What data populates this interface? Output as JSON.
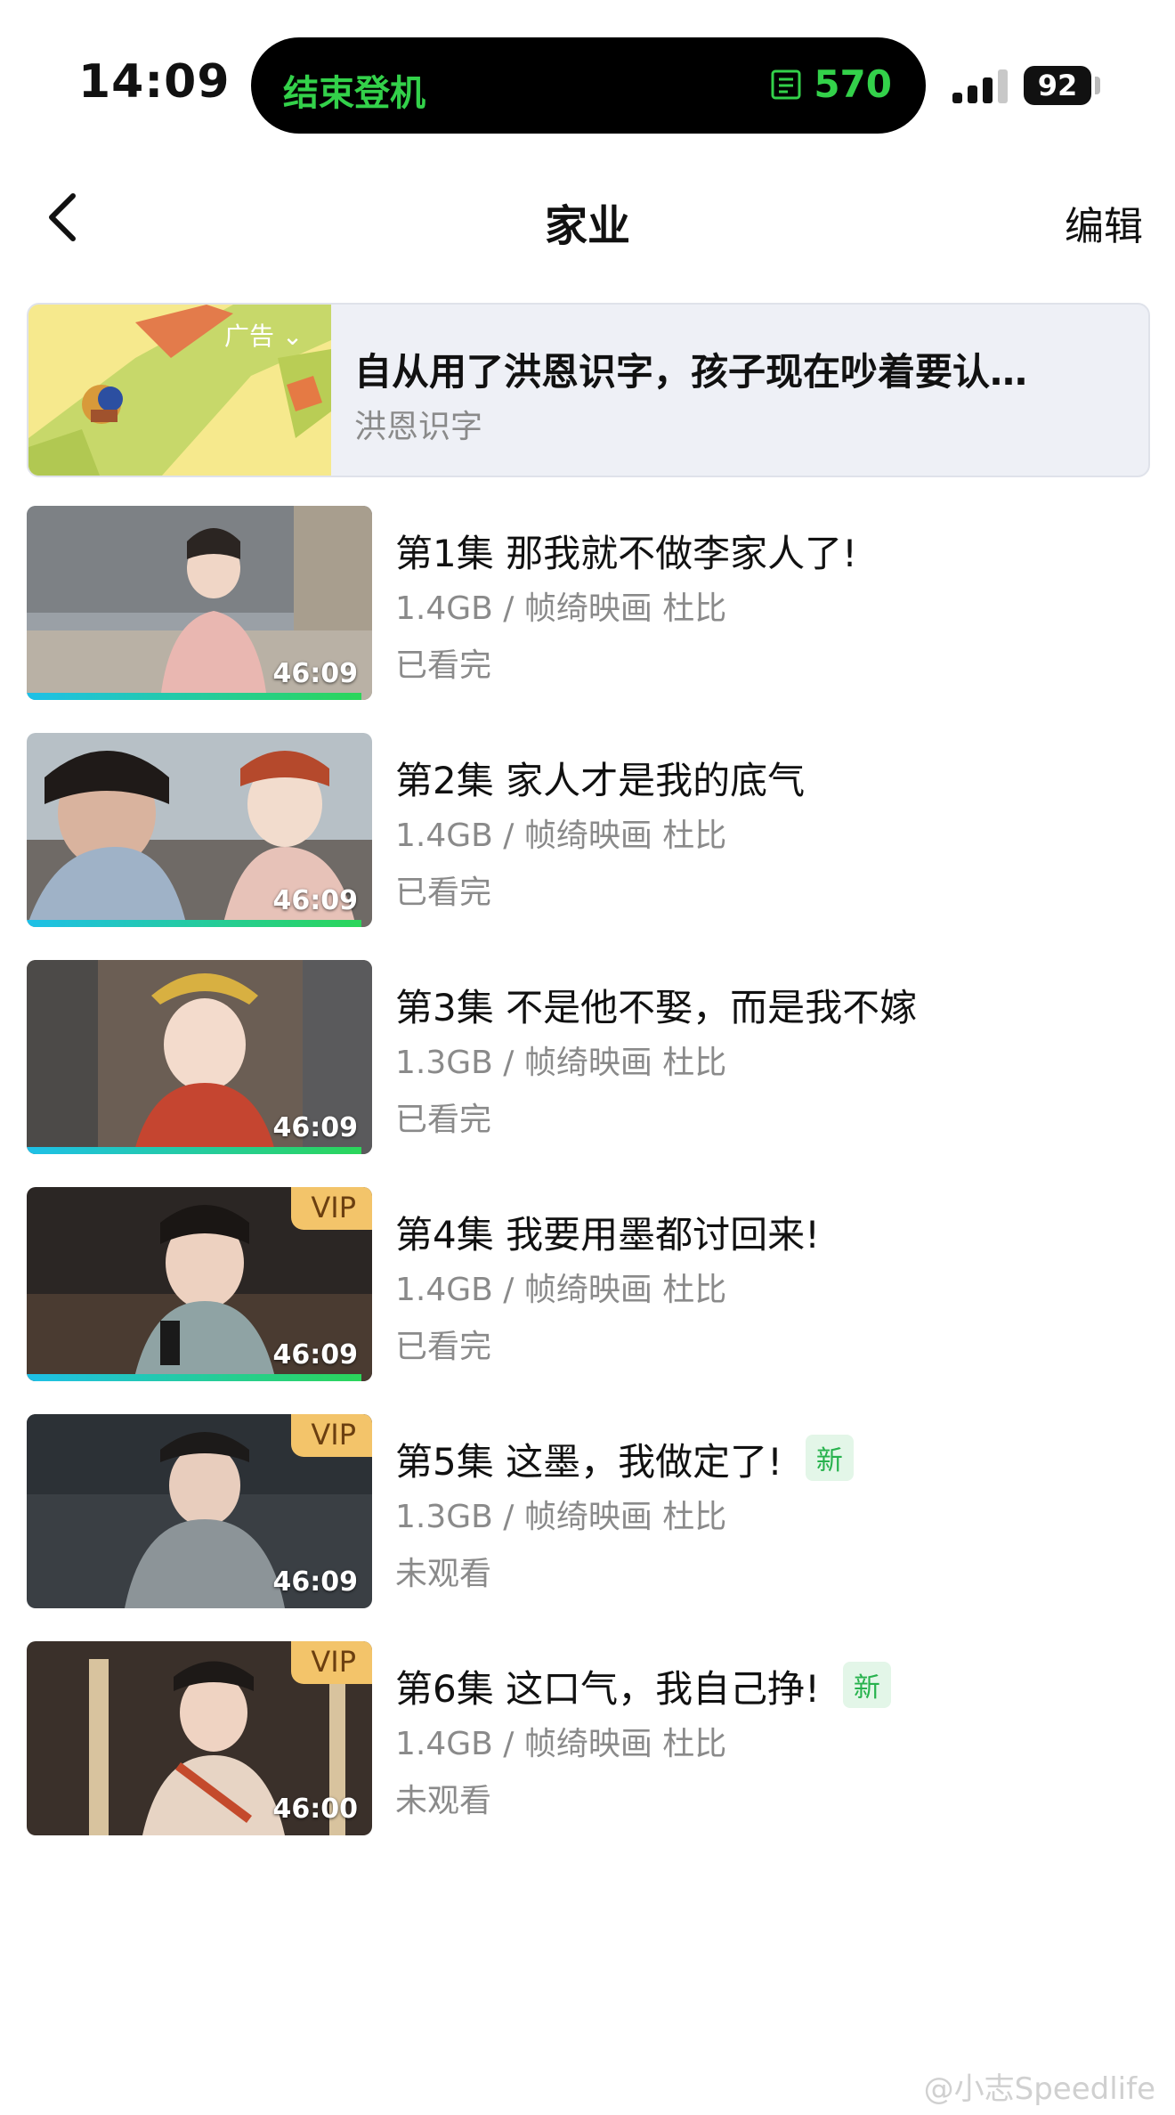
{
  "status_bar": {
    "time": "14:09",
    "island_left": "结束登机",
    "island_right": "570",
    "battery": "92",
    "accent": "#33d14a"
  },
  "nav": {
    "title": "家业",
    "edit_label": "编辑"
  },
  "ad": {
    "tag": "广告",
    "title": "自从用了洪恩识字，孩子现在吵着要认…",
    "subtitle": "洪恩识字"
  },
  "episodes": [
    {
      "title": "第1集  那我就不做李家人了!",
      "meta": "1.4GB / 帧绮映画  杜比",
      "status": "已看完",
      "duration": "46:09",
      "vip": "",
      "new": "",
      "progress": 0.97
    },
    {
      "title": "第2集  家人才是我的底气",
      "meta": "1.4GB / 帧绮映画  杜比",
      "status": "已看完",
      "duration": "46:09",
      "vip": "",
      "new": "",
      "progress": 0.97
    },
    {
      "title": "第3集  不是他不娶，而是我不嫁",
      "meta": "1.3GB / 帧绮映画  杜比",
      "status": "已看完",
      "duration": "46:09",
      "vip": "",
      "new": "",
      "progress": 0.97
    },
    {
      "title": "第4集  我要用墨都讨回来!",
      "meta": "1.4GB / 帧绮映画  杜比",
      "status": "已看完",
      "duration": "46:09",
      "vip": "VIP",
      "new": "",
      "progress": 0.97
    },
    {
      "title": "第5集  这墨，我做定了!",
      "meta": "1.3GB / 帧绮映画  杜比",
      "status": "未观看",
      "duration": "46:09",
      "vip": "VIP",
      "new": "新",
      "progress": 0
    },
    {
      "title": "第6集  这口气，我自己挣!",
      "meta": "1.4GB / 帧绮映画  杜比",
      "status": "未观看",
      "duration": "46:00",
      "vip": "VIP",
      "new": "新",
      "progress": 0
    }
  ],
  "watermark": "@小志Speedlife"
}
